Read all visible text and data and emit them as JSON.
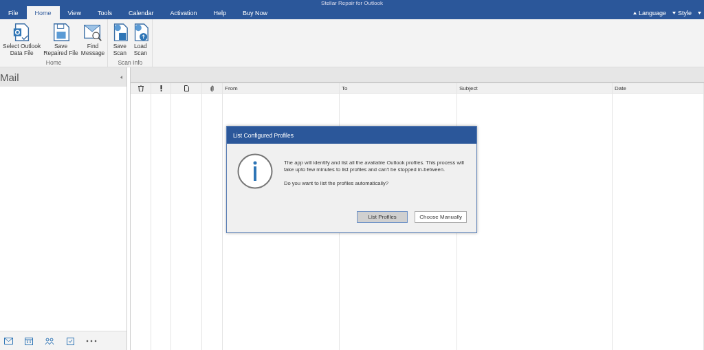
{
  "window": {
    "title": "Stellar Repair for Outlook"
  },
  "tabs": [
    {
      "label": "File",
      "selected": false
    },
    {
      "label": "Home",
      "selected": true
    },
    {
      "label": "View",
      "selected": false
    },
    {
      "label": "Tools",
      "selected": false
    },
    {
      "label": "Calendar",
      "selected": false
    },
    {
      "label": "Activation",
      "selected": false
    },
    {
      "label": "Help",
      "selected": false
    },
    {
      "label": "Buy Now",
      "selected": false
    }
  ],
  "menu_right": [
    {
      "label": "Language"
    },
    {
      "label": "Style"
    }
  ],
  "ribbon": [
    {
      "label": "Home",
      "buttons": [
        {
          "kind": "open",
          "label": "Select Outlook\nData File"
        },
        {
          "kind": "save",
          "label": "Save\nRepaired File"
        },
        {
          "kind": "find",
          "label": "Find\nMessage"
        }
      ]
    },
    {
      "label": "Scan Info",
      "buttons": [
        {
          "kind": "save-scan",
          "label": "Save\nScan"
        },
        {
          "kind": "load-scan",
          "label": "Load\nScan"
        }
      ]
    }
  ],
  "sidebar": {
    "title": "Mail"
  },
  "table": {
    "columns": [
      "From",
      "To",
      "Subject",
      "Date"
    ]
  },
  "dialog": {
    "title": "List Configured Profiles",
    "message": "The app will identify and list all the available Outlook profiles. This process will take upto few minutes to list profiles and can't be stopped in-between.",
    "question": "Do you want to list the profiles automatically?",
    "buttons": [
      {
        "label": "List Profiles",
        "selected": true
      },
      {
        "label": "Choose Manually",
        "selected": false
      }
    ]
  }
}
